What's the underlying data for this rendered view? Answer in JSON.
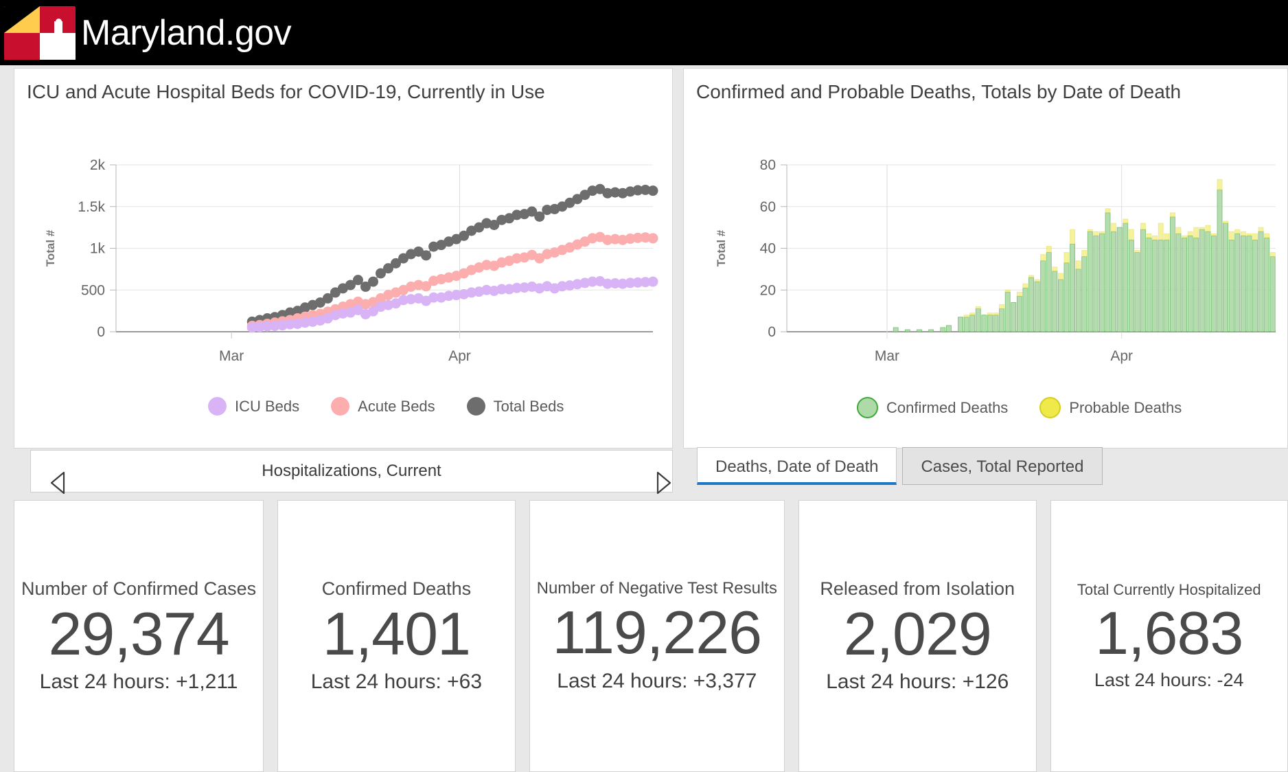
{
  "header": {
    "logo_icon": "maryland-flag-icon",
    "title": "Maryland.gov"
  },
  "side_tab": {
    "icon": "left-arrow-icon"
  },
  "left_chart": {
    "title": "ICU and Acute Hospital Beds for COVID-19, Currently in Use",
    "pager": {
      "prev_icon": "triangle-left-icon",
      "next_icon": "triangle-right-icon",
      "label": "Hospitalizations, Current"
    }
  },
  "right_chart": {
    "title": "Confirmed and Probable Deaths, Totals by Date of Death"
  },
  "tabs": [
    {
      "label": "Deaths, Date of Death",
      "active": true
    },
    {
      "label": "Cases, Total Reported",
      "active": false
    }
  ],
  "cards": [
    {
      "title": "Number of Confirmed Cases",
      "value": "29,374",
      "sub": "Last 24 hours: +1,211",
      "title_size": "md",
      "sub_size": "md"
    },
    {
      "title": "Confirmed Deaths",
      "value": "1,401",
      "sub": "Last 24 hours: +63",
      "title_size": "md",
      "sub_size": "md"
    },
    {
      "title": "Number of Negative Test Results",
      "value": "119,226",
      "sub": "Last 24 hours: +3,377",
      "title_size": "sm",
      "sub_size": "md"
    },
    {
      "title": "Released from Isolation",
      "value": "2,029",
      "sub": "Last 24 hours: +126",
      "title_size": "md",
      "sub_size": "md"
    },
    {
      "title": "Total Currently Hospitalized",
      "value": "1,683",
      "sub": "Last 24 hours: -24",
      "title_size": "xs",
      "sub_size": "sm"
    }
  ],
  "chart_data": [
    {
      "type": "scatter",
      "title": "ICU and Acute Hospital Beds for COVID-19, Currently in Use",
      "xlabel": "",
      "ylabel": "Total #",
      "ylim": [
        0,
        2000
      ],
      "yticks": [
        0,
        500,
        1000,
        1500,
        2000
      ],
      "ytick_labels": [
        "0",
        "500",
        "1k",
        "1.5k",
        "2k"
      ],
      "xtick_labels": [
        "Mar",
        "Apr"
      ],
      "xtick_positions": [
        0.215,
        0.64
      ],
      "grid": true,
      "legend_position": "bottom",
      "colors": {
        "ICU Beds": "#d8b3f5",
        "Acute Beds": "#fcadad",
        "Total Beds": "#6d6d6d"
      },
      "x_index_start": 18,
      "series": [
        {
          "name": "Total Beds",
          "color": "#6d6d6d",
          "values": [
            120,
            140,
            160,
            175,
            200,
            230,
            250,
            290,
            320,
            350,
            400,
            470,
            520,
            560,
            620,
            540,
            600,
            700,
            760,
            820,
            880,
            930,
            960,
            915,
            1020,
            1040,
            1080,
            1110,
            1150,
            1210,
            1250,
            1300,
            1280,
            1340,
            1360,
            1400,
            1410,
            1440,
            1380,
            1460,
            1470,
            1500,
            1545,
            1590,
            1640,
            1690,
            1710,
            1660,
            1670,
            1660,
            1680,
            1695,
            1700,
            1690
          ]
        },
        {
          "name": "Acute Beds",
          "color": "#fcadad",
          "values": [
            70,
            80,
            95,
            110,
            125,
            140,
            160,
            180,
            200,
            215,
            240,
            270,
            300,
            330,
            360,
            330,
            355,
            400,
            440,
            470,
            500,
            540,
            560,
            545,
            610,
            630,
            650,
            670,
            700,
            740,
            770,
            800,
            790,
            830,
            850,
            880,
            890,
            920,
            880,
            930,
            950,
            980,
            1010,
            1045,
            1080,
            1120,
            1135,
            1100,
            1110,
            1100,
            1115,
            1125,
            1130,
            1120
          ]
        },
        {
          "name": "ICU Beds",
          "color": "#d8b3f5",
          "values": [
            50,
            58,
            65,
            70,
            78,
            90,
            95,
            110,
            120,
            135,
            160,
            200,
            220,
            230,
            260,
            210,
            245,
            300,
            320,
            340,
            380,
            390,
            400,
            370,
            410,
            410,
            430,
            440,
            450,
            470,
            480,
            500,
            490,
            510,
            510,
            525,
            530,
            540,
            520,
            545,
            520,
            545,
            555,
            570,
            585,
            600,
            605,
            575,
            580,
            575,
            585,
            590,
            595,
            600
          ]
        }
      ]
    },
    {
      "type": "bar",
      "subtype": "stacked",
      "title": "Confirmed and Probable Deaths, Totals by Date of Death",
      "xlabel": "",
      "ylabel": "Total #",
      "ylim": [
        0,
        80
      ],
      "yticks": [
        0,
        20,
        40,
        60,
        80
      ],
      "ytick_labels": [
        "0",
        "20",
        "40",
        "60",
        "80"
      ],
      "xtick_labels": [
        "Mar",
        "Apr"
      ],
      "xtick_positions": [
        0.205,
        0.685
      ],
      "grid": true,
      "legend_position": "bottom",
      "colors": {
        "Confirmed Deaths": "#aedaa8",
        "Probable Deaths": "#efe94a"
      },
      "series": [
        {
          "name": "Confirmed Deaths",
          "color": "#aedaa8",
          "values": [
            0,
            0,
            0,
            0,
            0,
            0,
            0,
            0,
            0,
            0,
            0,
            0,
            0,
            0,
            0,
            0,
            0,
            0,
            2,
            0,
            1,
            0,
            1,
            0,
            1,
            0,
            2,
            3,
            0,
            7,
            7,
            8,
            11,
            8,
            8,
            8,
            11,
            19,
            14,
            17,
            21,
            26,
            24,
            34,
            38,
            29,
            25,
            33,
            42,
            30,
            36,
            48,
            46,
            47,
            57,
            48,
            50,
            52,
            44,
            38,
            49,
            45,
            44,
            44,
            44,
            55,
            47,
            45,
            46,
            45,
            49,
            48,
            46,
            68,
            52,
            44,
            47,
            46,
            46,
            44,
            48,
            45,
            36
          ]
        },
        {
          "name": "Probable Deaths",
          "color": "#efe94a",
          "values": [
            0,
            0,
            0,
            0,
            0,
            0,
            0,
            0,
            0,
            0,
            0,
            0,
            0,
            0,
            0,
            0,
            0,
            0,
            0,
            0,
            0,
            0,
            0,
            0,
            0,
            0,
            0,
            0,
            0,
            0,
            1,
            1,
            1,
            0,
            1,
            1,
            2,
            1,
            0,
            2,
            2,
            1,
            1,
            3,
            3,
            2,
            3,
            5,
            7,
            4,
            3,
            1,
            2,
            1,
            2,
            4,
            0,
            2,
            5,
            1,
            3,
            2,
            2,
            8,
            3,
            2,
            3,
            1,
            2,
            5,
            1,
            3,
            1,
            5,
            1,
            4,
            2,
            2,
            1,
            3,
            2,
            2,
            2
          ]
        }
      ]
    }
  ],
  "legends": {
    "left": [
      {
        "label": "ICU Beds",
        "color": "#d8b3f5"
      },
      {
        "label": "Acute Beds",
        "color": "#fcadad"
      },
      {
        "label": "Total Beds",
        "color": "#6d6d6d"
      }
    ],
    "right": [
      {
        "label": "Confirmed Deaths",
        "color": "#aedaa8",
        "border": "#3faa3c"
      },
      {
        "label": "Probable Deaths",
        "color": "#efe94a",
        "border": "#d4cf22"
      }
    ]
  }
}
